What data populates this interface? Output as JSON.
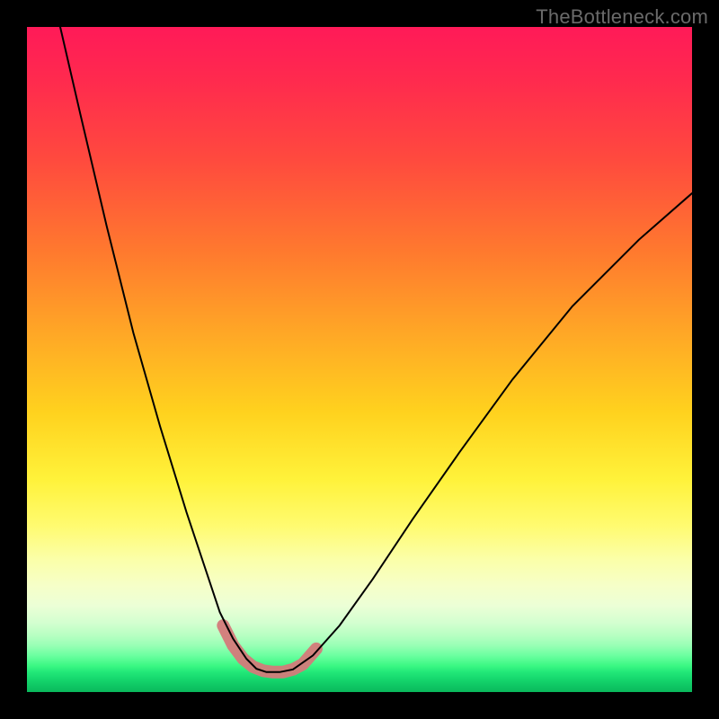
{
  "watermark": "TheBottleneck.com",
  "colors": {
    "frame_bg": "#000000",
    "curve": "#000000",
    "highlight": "#d47a7a"
  },
  "chart_data": {
    "type": "line",
    "title": "",
    "xlabel": "",
    "ylabel": "",
    "xlim": [
      0,
      100
    ],
    "ylim": [
      0,
      100
    ],
    "grid": false,
    "axes_visible": false,
    "annotation": "V-shaped bottleneck curve with highlighted minimum region",
    "series": [
      {
        "name": "bottleneck_curve",
        "x": [
          5,
          8,
          12,
          16,
          20,
          24,
          27,
          29,
          31,
          33,
          34.5,
          36,
          38,
          40,
          43,
          47,
          52,
          58,
          65,
          73,
          82,
          92,
          100
        ],
        "y": [
          100,
          87,
          70,
          54,
          40,
          27,
          18,
          12,
          8,
          5,
          3.5,
          3,
          3,
          3.4,
          5.5,
          10,
          17,
          26,
          36,
          47,
          58,
          68,
          75
        ]
      }
    ],
    "highlight_region": {
      "x": [
        29.5,
        31,
        32.5,
        34,
        35.5,
        37,
        38.5,
        40,
        41.5,
        43.5
      ],
      "y": [
        10,
        7,
        5,
        3.8,
        3.2,
        3,
        3,
        3.4,
        4.2,
        6.5
      ]
    }
  }
}
